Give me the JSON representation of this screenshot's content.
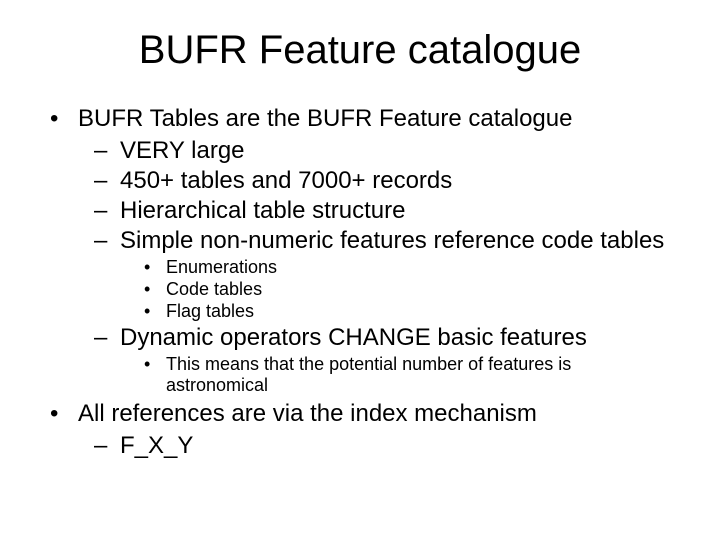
{
  "title": "BUFR Feature catalogue",
  "bullets": {
    "b1": "BUFR Tables are the BUFR Feature catalogue",
    "b1_1": "VERY large",
    "b1_2": "450+ tables and 7000+ records",
    "b1_3": "Hierarchical table structure",
    "b1_4": "Simple non-numeric features reference code tables",
    "b1_4_1": "Enumerations",
    "b1_4_2": "Code tables",
    "b1_4_3": "Flag tables",
    "b1_5": "Dynamic operators CHANGE basic features",
    "b1_5_1": "This means that the potential number of features is astronomical",
    "b2": "All references are via the index mechanism",
    "b2_1": "F_X_Y"
  },
  "glyph": {
    "dot": "•",
    "dash": "–"
  }
}
